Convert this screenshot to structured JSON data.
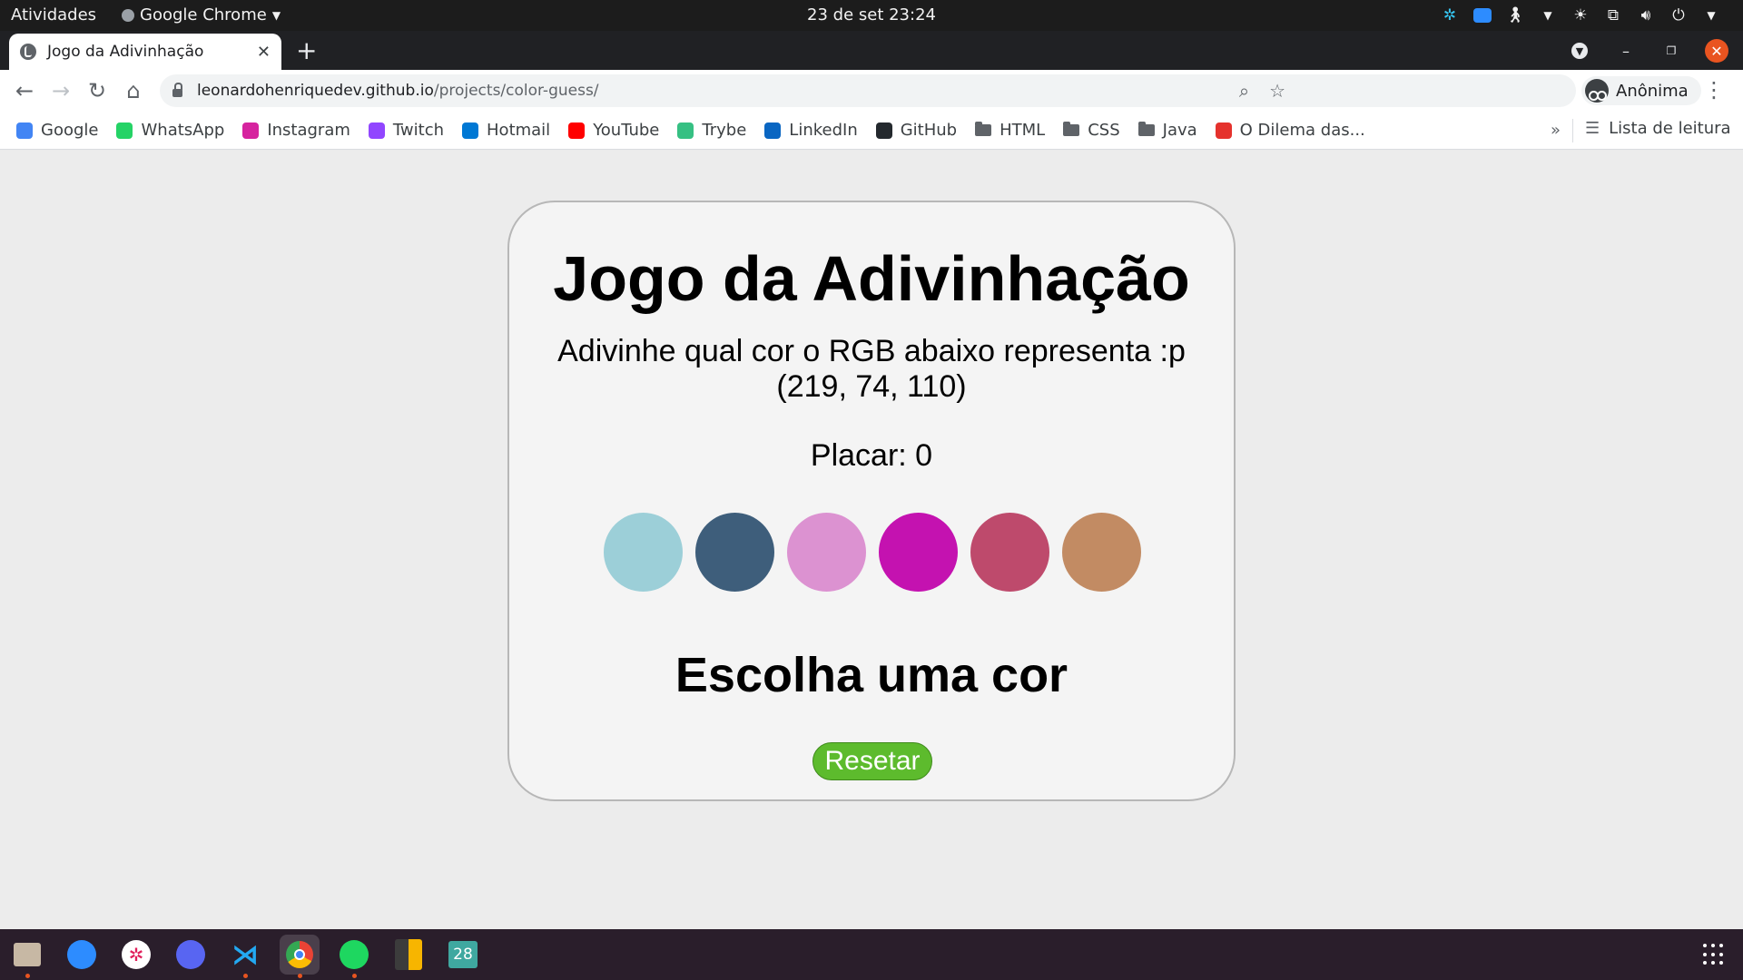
{
  "topbar": {
    "activities": "Atividades",
    "app_name": "Google Chrome",
    "clock": "23 de set  23:24"
  },
  "tab": {
    "title": "Jogo da Adivinhação"
  },
  "address_bar": {
    "host": "leonardohenriquedev.github.io",
    "path": "/projects/color-guess/",
    "profile_label": "Anônima"
  },
  "bookmarks": [
    {
      "label": "Google",
      "icon": "google-icon",
      "color": "#4285f4"
    },
    {
      "label": "WhatsApp",
      "icon": "whatsapp-icon",
      "color": "#25d366"
    },
    {
      "label": "Instagram",
      "icon": "instagram-icon",
      "color": "#d6249f"
    },
    {
      "label": "Twitch",
      "icon": "twitch-icon",
      "color": "#9146ff"
    },
    {
      "label": "Hotmail",
      "icon": "outlook-icon",
      "color": "#0078d4"
    },
    {
      "label": "YouTube",
      "icon": "youtube-icon",
      "color": "#ff0000"
    },
    {
      "label": "Trybe",
      "icon": "trybe-icon",
      "color": "#36c083"
    },
    {
      "label": "LinkedIn",
      "icon": "linkedin-icon",
      "color": "#0a66c2"
    },
    {
      "label": "GitHub",
      "icon": "github-icon",
      "color": "#24292e"
    },
    {
      "label": "HTML",
      "icon": "folder-icon"
    },
    {
      "label": "CSS",
      "icon": "folder-icon"
    },
    {
      "label": "Java",
      "icon": "folder-icon"
    },
    {
      "label": "O Dilema das...",
      "icon": "adobe-icon",
      "color": "#e5322d"
    }
  ],
  "bookmarks_more": "»",
  "reading_list": "Lista de leitura",
  "game": {
    "title": "Jogo da Adivinhação",
    "subtitle": "Adivinhe qual cor o RGB abaixo representa :p",
    "rgb_text": "(219, 74, 110)",
    "score_text": "Placar: 0",
    "answer_text": "Escolha uma cor",
    "reset_label": "Resetar",
    "ball_colors": [
      "#9ccfd8",
      "#3e5e7b",
      "#dc92d1",
      "#c412b0",
      "#be4a6c",
      "#c28b63"
    ]
  },
  "dock": {
    "apps": [
      "files-icon",
      "zoom-icon",
      "slack-icon",
      "discord-icon",
      "vscode-icon",
      "chrome-icon",
      "spotify-icon",
      "calculator-icon",
      "calendar-icon"
    ],
    "calendar_day": "28"
  }
}
